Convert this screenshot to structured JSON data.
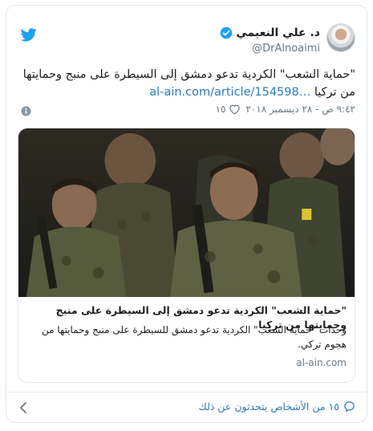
{
  "header": {
    "name": "د. علي النعيمي",
    "handle": "@DrAlnoaimi"
  },
  "tweet": {
    "text": "\"حماية الشعب\" الكردية تدعو دمشق إلى السيطرة على منبج وحمايتها من تركيا",
    "link": "al-ain.com/article/154598…",
    "timestamp": "٩:٤٢ ص - ٢٨ ديسمبر ٢٠١٨",
    "likes": "١٥"
  },
  "card": {
    "title": "\"حماية الشعب\" الكردية تدعو دمشق إلى السيطرة على منبج وحمايتها من تركيا",
    "description": "وحدات \"حماية الشعب\" الكردية تدعو دمشق للسيطرة على منبج وحمايتها من هجوم تركي.",
    "domain": "al-ain.com"
  },
  "footer": {
    "conversation": "١٥ من الأشخاص يتحدثون عن ذلك"
  },
  "colors": {
    "link": "#2b7bb9",
    "verified": "#1da1f2",
    "border": "#e1e8ed",
    "muted": "#697882"
  }
}
